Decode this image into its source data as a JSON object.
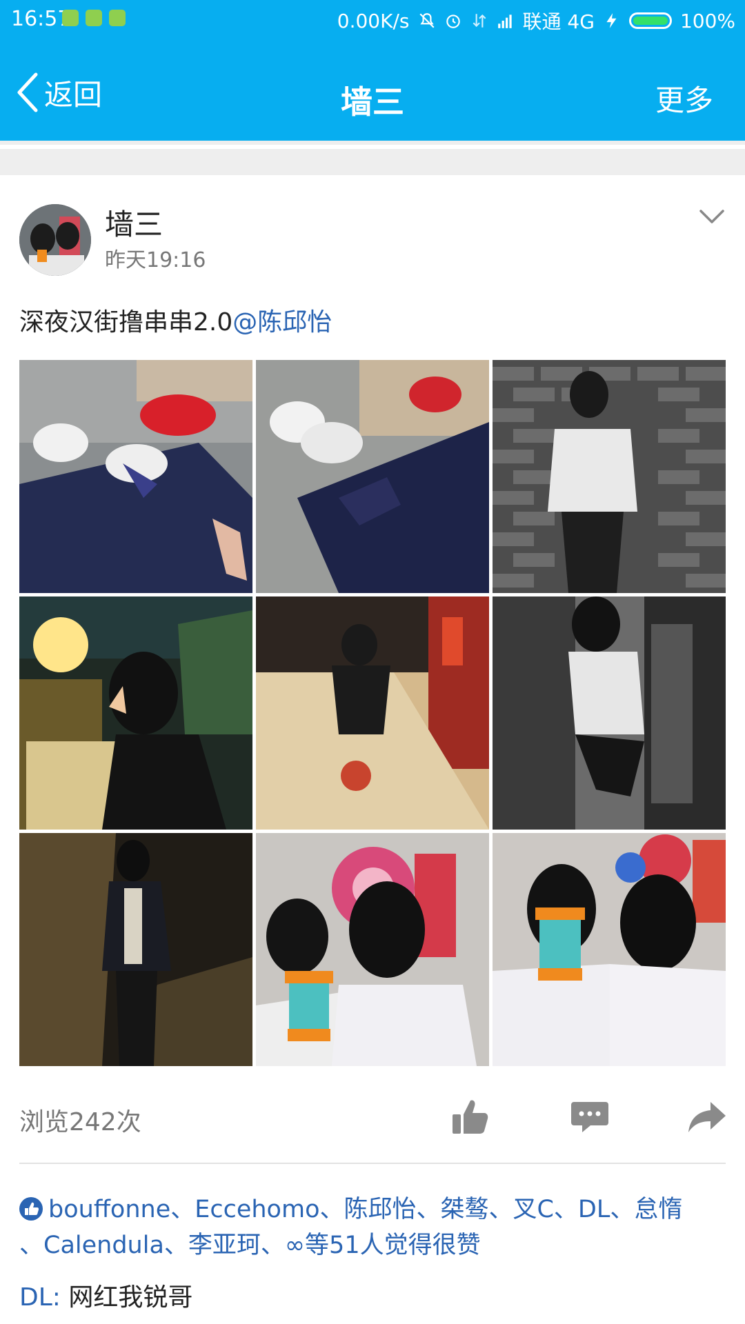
{
  "status_bar": {
    "time": "16:57",
    "speed": "0.00K/s",
    "carrier": "联通 4G",
    "battery": "100%"
  },
  "header": {
    "back_label": "返回",
    "title": "墙三",
    "more_label": "更多",
    "accent": "#07aef0"
  },
  "post": {
    "author": "墙三",
    "time": "昨天19:16",
    "text": "深夜汉街撸串串2.0",
    "mention": "@陈邱怡",
    "photos": [
      "photo-sneakers-1",
      "photo-sneakers-2",
      "photo-brick-wall-portrait",
      "photo-night-profile",
      "photo-street-squat",
      "photo-bw-doorway",
      "photo-stone-wall-night",
      "photo-cups-1",
      "photo-cups-2"
    ],
    "views": "浏览242次",
    "likes_line1": "bouffonne、Eccehomo、陈邱怡、桀骜、叉C、DL、怠惰",
    "likes_line2": "、Calendula、李亚珂、∞等51人觉得很赞",
    "comment_user": "DL:",
    "comment_text": " 网红我锐哥"
  },
  "icons": {
    "back": "chevron-left-icon",
    "dropdown": "chevron-down-icon",
    "like": "thumbs-up-icon",
    "comment": "comment-icon",
    "share": "share-icon"
  }
}
